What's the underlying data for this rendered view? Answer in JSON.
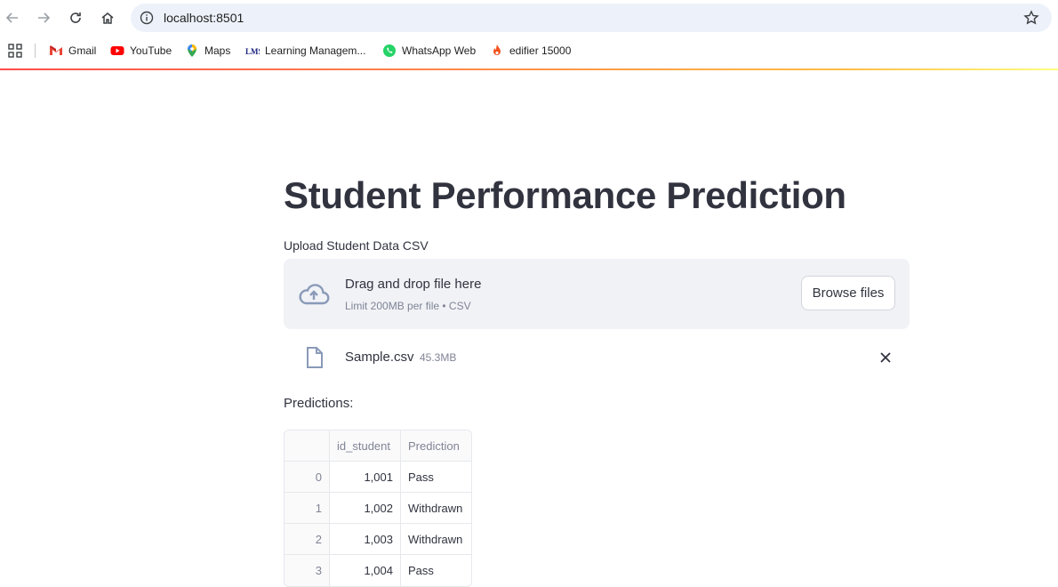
{
  "browser": {
    "url": "localhost:8501",
    "bookmarks": [
      {
        "label": "Gmail",
        "icon": "gmail-icon"
      },
      {
        "label": "YouTube",
        "icon": "youtube-icon"
      },
      {
        "label": "Maps",
        "icon": "maps-icon"
      },
      {
        "label": "Learning Managem...",
        "icon": "lms-icon"
      },
      {
        "label": "WhatsApp Web",
        "icon": "whatsapp-icon"
      },
      {
        "label": "edifier 15000",
        "icon": "edifier-icon"
      }
    ]
  },
  "app": {
    "title": "Student Performance Prediction",
    "uploader": {
      "label": "Upload Student Data CSV",
      "drag_text": "Drag and drop file here",
      "limit_text": "Limit 200MB per file • CSV",
      "browse_label": "Browse files"
    },
    "uploaded_file": {
      "name": "Sample.csv",
      "size": "45.3MB"
    },
    "predictions_label": "Predictions:",
    "table": {
      "columns": [
        "",
        "id_student",
        "Prediction"
      ],
      "rows": [
        {
          "index": "0",
          "id_student": "1,001",
          "prediction": "Pass"
        },
        {
          "index": "1",
          "id_student": "1,002",
          "prediction": "Withdrawn"
        },
        {
          "index": "2",
          "id_student": "1,003",
          "prediction": "Withdrawn"
        },
        {
          "index": "3",
          "id_student": "1,004",
          "prediction": "Pass"
        }
      ]
    }
  },
  "colors": {
    "accent_red": "#ff4b4b",
    "text": "#31333f",
    "muted": "#808495",
    "dropzone_bg": "#f0f2f6"
  }
}
